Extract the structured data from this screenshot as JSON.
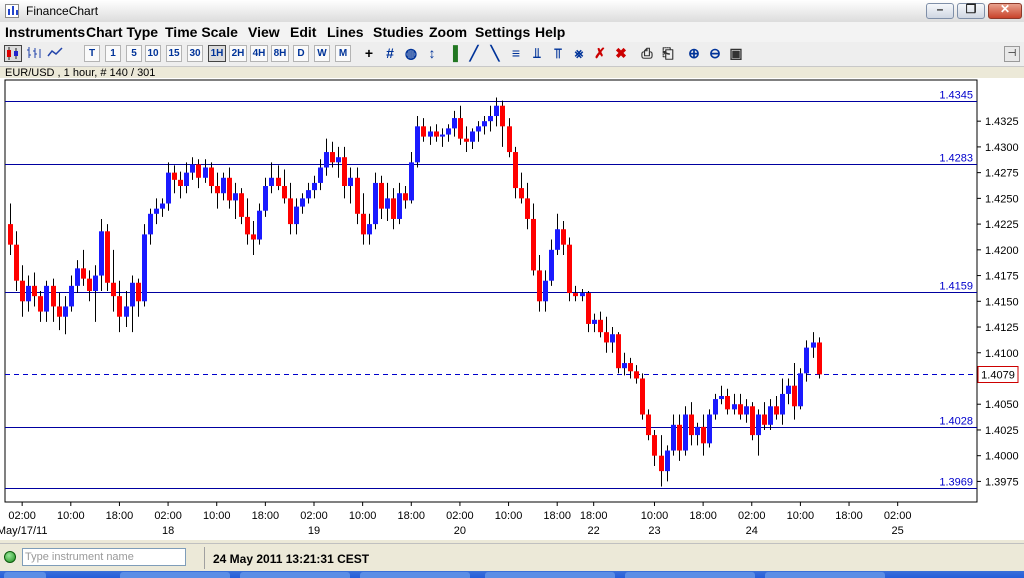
{
  "window": {
    "title": "FinanceChart"
  },
  "window_controls": {
    "minimize": "–",
    "maximize": "❐",
    "close": "✕"
  },
  "menu": [
    "Instruments",
    "Chart Type",
    "Time Scale",
    "View",
    "Edit",
    "Lines",
    "Studies",
    "Zoom",
    "Settings",
    "Help"
  ],
  "toolbar": {
    "chart_icons": [
      "candlestick-chart-icon",
      "bar-chart-icon",
      "line-chart-icon"
    ],
    "timeframes": [
      "T",
      "1",
      "5",
      "10",
      "15",
      "30",
      "1H",
      "2H",
      "4H",
      "8H",
      "D",
      "W",
      "M"
    ],
    "active_timeframe": "1H",
    "tools": [
      {
        "name": "crosshair-icon",
        "glyph": "+"
      },
      {
        "name": "grid-icon",
        "glyph": "#"
      },
      {
        "name": "price-marker-icon",
        "glyph": "◍"
      },
      {
        "name": "indicator-icon",
        "glyph": "↕"
      },
      {
        "name": "volume-icon",
        "glyph": "▐"
      },
      {
        "name": "trend-line-icon",
        "glyph": "╱"
      },
      {
        "name": "channel-icon",
        "glyph": "╲"
      },
      {
        "name": "fibonacci-icon",
        "glyph": "≡"
      },
      {
        "name": "pitchfork-icon",
        "glyph": "⫫"
      },
      {
        "name": "cycle-lines-icon",
        "glyph": "⫪"
      },
      {
        "name": "gann-icon",
        "glyph": "⨳"
      },
      {
        "name": "delete-line-icon",
        "glyph": "✗"
      },
      {
        "name": "delete-all-icon",
        "glyph": "✖"
      },
      {
        "name": "print-icon",
        "glyph": "⎙"
      },
      {
        "name": "print-preview-icon",
        "glyph": "⎗"
      },
      {
        "name": "zoom-in-icon",
        "glyph": "⊕"
      },
      {
        "name": "zoom-out-icon",
        "glyph": "⊖"
      },
      {
        "name": "zoom-fit-icon",
        "glyph": "▣"
      }
    ],
    "pin_icon": "pin-icon"
  },
  "symbol_label": "EUR/USD , 1 hour, # 140 / 301",
  "chart_data": {
    "type": "candlestick",
    "instrument": "EUR/USD",
    "timeframe": "1 hour",
    "bar_index": 140,
    "bar_count": 301,
    "ylim": [
      1.3955,
      1.4365
    ],
    "yticks": [
      "1.4325",
      "1.4300",
      "1.4275",
      "1.4250",
      "1.4225",
      "1.4200",
      "1.4175",
      "1.4150",
      "1.4125",
      "1.4100",
      "1.4075",
      "1.4050",
      "1.4025",
      "1.4000",
      "1.3975"
    ],
    "xticks": [
      {
        "label": "02:00",
        "sub": "May/17/11",
        "hour": 2
      },
      {
        "label": "10:00",
        "sub": "",
        "hour": 10
      },
      {
        "label": "18:00",
        "sub": "",
        "hour": 18
      },
      {
        "label": "02:00",
        "sub": "18",
        "hour": 26
      },
      {
        "label": "10:00",
        "sub": "",
        "hour": 34
      },
      {
        "label": "18:00",
        "sub": "",
        "hour": 42
      },
      {
        "label": "02:00",
        "sub": "19",
        "hour": 50
      },
      {
        "label": "10:00",
        "sub": "",
        "hour": 58
      },
      {
        "label": "18:00",
        "sub": "",
        "hour": 66
      },
      {
        "label": "02:00",
        "sub": "20",
        "hour": 74
      },
      {
        "label": "10:00",
        "sub": "",
        "hour": 82
      },
      {
        "label": "18:00",
        "sub": "",
        "hour": 90
      },
      {
        "label": "18:00",
        "sub": "22",
        "hour": 96
      },
      {
        "label": "10:00",
        "sub": "23",
        "hour": 106
      },
      {
        "label": "18:00",
        "sub": "",
        "hour": 114
      },
      {
        "label": "02:00",
        "sub": "24",
        "hour": 122
      },
      {
        "label": "10:00",
        "sub": "",
        "hour": 130
      },
      {
        "label": "18:00",
        "sub": "",
        "hour": 138
      },
      {
        "label": "02:00",
        "sub": "25",
        "hour": 146
      }
    ],
    "hlines": [
      {
        "value": 1.4345,
        "label": "1.4345",
        "style": "solid"
      },
      {
        "value": 1.4283,
        "label": "1.4283",
        "style": "solid"
      },
      {
        "value": 1.4159,
        "label": "1.4159",
        "style": "solid"
      },
      {
        "value": 1.4028,
        "label": "1.4028",
        "style": "solid"
      },
      {
        "value": 1.3969,
        "label": "1.3969",
        "style": "solid"
      }
    ],
    "current_price": {
      "value": 1.4079,
      "label": "1.4079"
    },
    "up_color": "#1a1aff",
    "down_color": "#ff0000",
    "line_color": "#0000a0",
    "grid": false,
    "candles": [
      [
        1.4225,
        1.4245,
        1.4195,
        1.4205
      ],
      [
        1.4205,
        1.4218,
        1.416,
        1.417
      ],
      [
        1.417,
        1.4185,
        1.4135,
        1.415
      ],
      [
        1.415,
        1.4175,
        1.414,
        1.4165
      ],
      [
        1.4165,
        1.4178,
        1.4145,
        1.4155
      ],
      [
        1.4155,
        1.416,
        1.413,
        1.414
      ],
      [
        1.414,
        1.417,
        1.413,
        1.4165
      ],
      [
        1.4165,
        1.4172,
        1.413,
        1.4145
      ],
      [
        1.4145,
        1.4158,
        1.4122,
        1.4135
      ],
      [
        1.4135,
        1.4155,
        1.4118,
        1.4145
      ],
      [
        1.4145,
        1.4175,
        1.414,
        1.4165
      ],
      [
        1.4165,
        1.419,
        1.4158,
        1.4182
      ],
      [
        1.4182,
        1.42,
        1.4165,
        1.4172
      ],
      [
        1.4172,
        1.418,
        1.415,
        1.416
      ],
      [
        1.416,
        1.4185,
        1.413,
        1.4175
      ],
      [
        1.4175,
        1.423,
        1.416,
        1.4218
      ],
      [
        1.4218,
        1.4225,
        1.416,
        1.4168
      ],
      [
        1.4168,
        1.42,
        1.414,
        1.4155
      ],
      [
        1.4155,
        1.417,
        1.412,
        1.4135
      ],
      [
        1.4135,
        1.416,
        1.4125,
        1.4145
      ],
      [
        1.4145,
        1.4175,
        1.412,
        1.4168
      ],
      [
        1.4168,
        1.4172,
        1.4135,
        1.415
      ],
      [
        1.415,
        1.4225,
        1.4145,
        1.4215
      ],
      [
        1.4215,
        1.424,
        1.4205,
        1.4235
      ],
      [
        1.4235,
        1.425,
        1.4225,
        1.424
      ],
      [
        1.424,
        1.425,
        1.4232,
        1.4245
      ],
      [
        1.4245,
        1.4285,
        1.4238,
        1.4275
      ],
      [
        1.4275,
        1.4282,
        1.4255,
        1.4268
      ],
      [
        1.4268,
        1.4276,
        1.425,
        1.4262
      ],
      [
        1.4262,
        1.4285,
        1.4255,
        1.4275
      ],
      [
        1.4275,
        1.429,
        1.4268,
        1.4283
      ],
      [
        1.4283,
        1.4288,
        1.426,
        1.427
      ],
      [
        1.427,
        1.4288,
        1.4265,
        1.428
      ],
      [
        1.428,
        1.4285,
        1.4255,
        1.4262
      ],
      [
        1.4262,
        1.4275,
        1.424,
        1.4255
      ],
      [
        1.4255,
        1.4275,
        1.4248,
        1.427
      ],
      [
        1.427,
        1.428,
        1.424,
        1.4248
      ],
      [
        1.4248,
        1.4265,
        1.423,
        1.4255
      ],
      [
        1.4255,
        1.426,
        1.4225,
        1.4232
      ],
      [
        1.4232,
        1.425,
        1.4205,
        1.4215
      ],
      [
        1.4215,
        1.4228,
        1.4195,
        1.421
      ],
      [
        1.421,
        1.4245,
        1.4205,
        1.4238
      ],
      [
        1.4238,
        1.427,
        1.4232,
        1.4262
      ],
      [
        1.4262,
        1.4285,
        1.4255,
        1.427
      ],
      [
        1.427,
        1.4282,
        1.4258,
        1.4262
      ],
      [
        1.4262,
        1.4278,
        1.4245,
        1.425
      ],
      [
        1.425,
        1.4265,
        1.4215,
        1.4225
      ],
      [
        1.4225,
        1.425,
        1.4215,
        1.4242
      ],
      [
        1.4242,
        1.4255,
        1.4235,
        1.425
      ],
      [
        1.425,
        1.4265,
        1.4245,
        1.4258
      ],
      [
        1.4258,
        1.4272,
        1.425,
        1.4265
      ],
      [
        1.4265,
        1.4288,
        1.4258,
        1.428
      ],
      [
        1.428,
        1.4308,
        1.4272,
        1.4295
      ],
      [
        1.4295,
        1.4305,
        1.428,
        1.4285
      ],
      [
        1.4285,
        1.43,
        1.427,
        1.429
      ],
      [
        1.429,
        1.43,
        1.425,
        1.4262
      ],
      [
        1.4262,
        1.428,
        1.4245,
        1.427
      ],
      [
        1.427,
        1.428,
        1.4225,
        1.4235
      ],
      [
        1.4235,
        1.4255,
        1.4205,
        1.4215
      ],
      [
        1.4215,
        1.4235,
        1.4205,
        1.4225
      ],
      [
        1.4225,
        1.4275,
        1.422,
        1.4265
      ],
      [
        1.4265,
        1.4272,
        1.423,
        1.424
      ],
      [
        1.424,
        1.4265,
        1.4228,
        1.425
      ],
      [
        1.425,
        1.426,
        1.422,
        1.423
      ],
      [
        1.423,
        1.4265,
        1.4225,
        1.4255
      ],
      [
        1.4255,
        1.4262,
        1.424,
        1.4248
      ],
      [
        1.4248,
        1.4295,
        1.4245,
        1.4285
      ],
      [
        1.4285,
        1.433,
        1.428,
        1.432
      ],
      [
        1.432,
        1.4328,
        1.4305,
        1.431
      ],
      [
        1.431,
        1.432,
        1.4302,
        1.4315
      ],
      [
        1.4315,
        1.4322,
        1.4305,
        1.431
      ],
      [
        1.431,
        1.4318,
        1.43,
        1.4312
      ],
      [
        1.4312,
        1.4322,
        1.4305,
        1.4318
      ],
      [
        1.4318,
        1.4335,
        1.431,
        1.4328
      ],
      [
        1.4328,
        1.434,
        1.4302,
        1.4308
      ],
      [
        1.4308,
        1.432,
        1.4295,
        1.4305
      ],
      [
        1.4305,
        1.4318,
        1.4298,
        1.4315
      ],
      [
        1.4315,
        1.4325,
        1.4305,
        1.432
      ],
      [
        1.432,
        1.433,
        1.4312,
        1.4325
      ],
      [
        1.4325,
        1.434,
        1.4315,
        1.433
      ],
      [
        1.433,
        1.4348,
        1.432,
        1.434
      ],
      [
        1.434,
        1.4345,
        1.43,
        1.432
      ],
      [
        1.432,
        1.4328,
        1.429,
        1.4295
      ],
      [
        1.4295,
        1.43,
        1.425,
        1.426
      ],
      [
        1.426,
        1.4275,
        1.4245,
        1.425
      ],
      [
        1.425,
        1.4265,
        1.422,
        1.423
      ],
      [
        1.423,
        1.4245,
        1.4175,
        1.418
      ],
      [
        1.418,
        1.4195,
        1.414,
        1.415
      ],
      [
        1.415,
        1.418,
        1.414,
        1.417
      ],
      [
        1.417,
        1.421,
        1.4165,
        1.42
      ],
      [
        1.42,
        1.4235,
        1.4195,
        1.422
      ],
      [
        1.422,
        1.4228,
        1.4195,
        1.4205
      ],
      [
        1.4205,
        1.4212,
        1.415,
        1.4158
      ],
      [
        1.4158,
        1.4165,
        1.415,
        1.4155
      ],
      [
        1.4155,
        1.4162,
        1.415,
        1.4158
      ],
      [
        1.4158,
        1.416,
        1.412,
        1.4128
      ],
      [
        1.4128,
        1.4138,
        1.412,
        1.4132
      ],
      [
        1.4132,
        1.414,
        1.4115,
        1.412
      ],
      [
        1.412,
        1.4135,
        1.41,
        1.411
      ],
      [
        1.411,
        1.4125,
        1.41,
        1.4118
      ],
      [
        1.4118,
        1.412,
        1.408,
        1.4085
      ],
      [
        1.4085,
        1.41,
        1.4078,
        1.409
      ],
      [
        1.409,
        1.4095,
        1.4075,
        1.4082
      ],
      [
        1.4082,
        1.4088,
        1.407,
        1.4075
      ],
      [
        1.4075,
        1.408,
        1.4035,
        1.404
      ],
      [
        1.404,
        1.4045,
        1.4015,
        1.402
      ],
      [
        1.402,
        1.4025,
        1.399,
        1.4
      ],
      [
        1.4,
        1.402,
        1.397,
        1.3985
      ],
      [
        1.3985,
        1.401,
        1.3975,
        1.4005
      ],
      [
        1.4005,
        1.404,
        1.4,
        1.403
      ],
      [
        1.403,
        1.404,
        1.3995,
        1.4005
      ],
      [
        1.4005,
        1.4048,
        1.4,
        1.404
      ],
      [
        1.404,
        1.4052,
        1.401,
        1.402
      ],
      [
        1.402,
        1.4032,
        1.401,
        1.4028
      ],
      [
        1.4028,
        1.404,
        1.4,
        1.4012
      ],
      [
        1.4012,
        1.4045,
        1.4008,
        1.404
      ],
      [
        1.404,
        1.406,
        1.4035,
        1.4055
      ],
      [
        1.4055,
        1.4068,
        1.405,
        1.4058
      ],
      [
        1.4058,
        1.4065,
        1.404,
        1.4045
      ],
      [
        1.4045,
        1.406,
        1.404,
        1.405
      ],
      [
        1.405,
        1.406,
        1.4035,
        1.404
      ],
      [
        1.404,
        1.4055,
        1.4032,
        1.4048
      ],
      [
        1.4048,
        1.4052,
        1.4015,
        1.402
      ],
      [
        1.402,
        1.4045,
        1.4,
        1.404
      ],
      [
        1.404,
        1.4052,
        1.4025,
        1.403
      ],
      [
        1.403,
        1.4055,
        1.4025,
        1.4048
      ],
      [
        1.4048,
        1.4058,
        1.4035,
        1.404
      ],
      [
        1.404,
        1.4075,
        1.403,
        1.406
      ],
      [
        1.406,
        1.4075,
        1.405,
        1.4068
      ],
      [
        1.4068,
        1.409,
        1.4035,
        1.4048
      ],
      [
        1.4048,
        1.4085,
        1.4045,
        1.408
      ],
      [
        1.408,
        1.4112,
        1.4072,
        1.4105
      ],
      [
        1.4105,
        1.412,
        1.4095,
        1.411
      ],
      [
        1.411,
        1.4115,
        1.4075,
        1.4079
      ]
    ]
  },
  "status": {
    "input_placeholder": "Type instrument name",
    "datetime": "24 May 2011 13:21:31 CEST"
  }
}
